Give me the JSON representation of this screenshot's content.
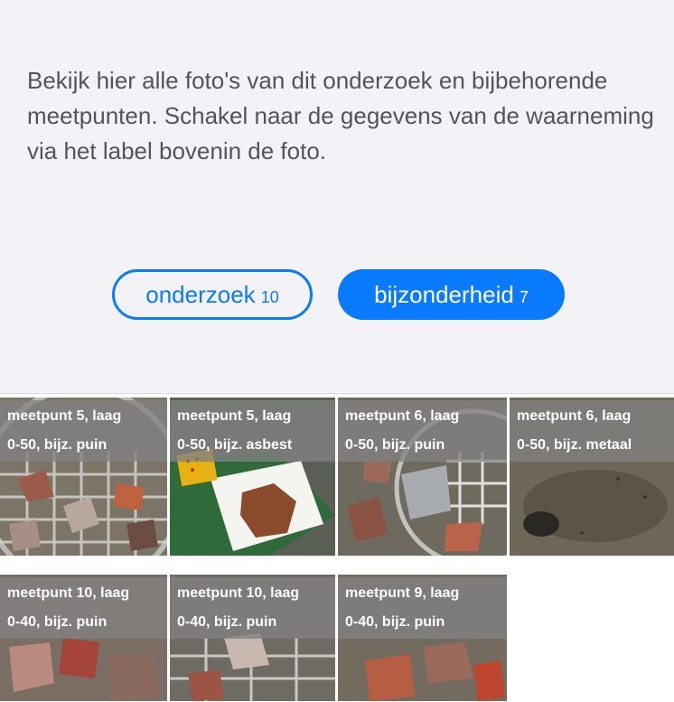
{
  "intro_text": "Bekijk hier alle foto's van dit onderzoek en bijbehorende meetpunten. Schakel naar de gegevens van de waarneming via het label bovenin de foto.",
  "filters": {
    "onderzoek": {
      "label": "onderzoek",
      "count": "10"
    },
    "bijzonderheid": {
      "label": "bijzonderheid",
      "count": "7"
    }
  },
  "accent_color": "#0a7aff",
  "photos": [
    {
      "label": "meetpunt 5, laag\n0-50, bijz. puin",
      "subject": "puin"
    },
    {
      "label": "meetpunt 5, laag\n0-50, bijz. asbest",
      "subject": "asbest"
    },
    {
      "label": "meetpunt 6, laag\n0-50, bijz. puin",
      "subject": "puin"
    },
    {
      "label": "meetpunt 6, laag\n0-50, bijz. metaal",
      "subject": "metaal"
    },
    {
      "label": "meetpunt 10, laag\n0-40, bijz. puin",
      "subject": "puin"
    },
    {
      "label": "meetpunt 10, laag\n0-40, bijz. puin",
      "subject": "puin"
    },
    {
      "label": "meetpunt 9, laag\n0-40, bijz. puin",
      "subject": "puin"
    }
  ]
}
